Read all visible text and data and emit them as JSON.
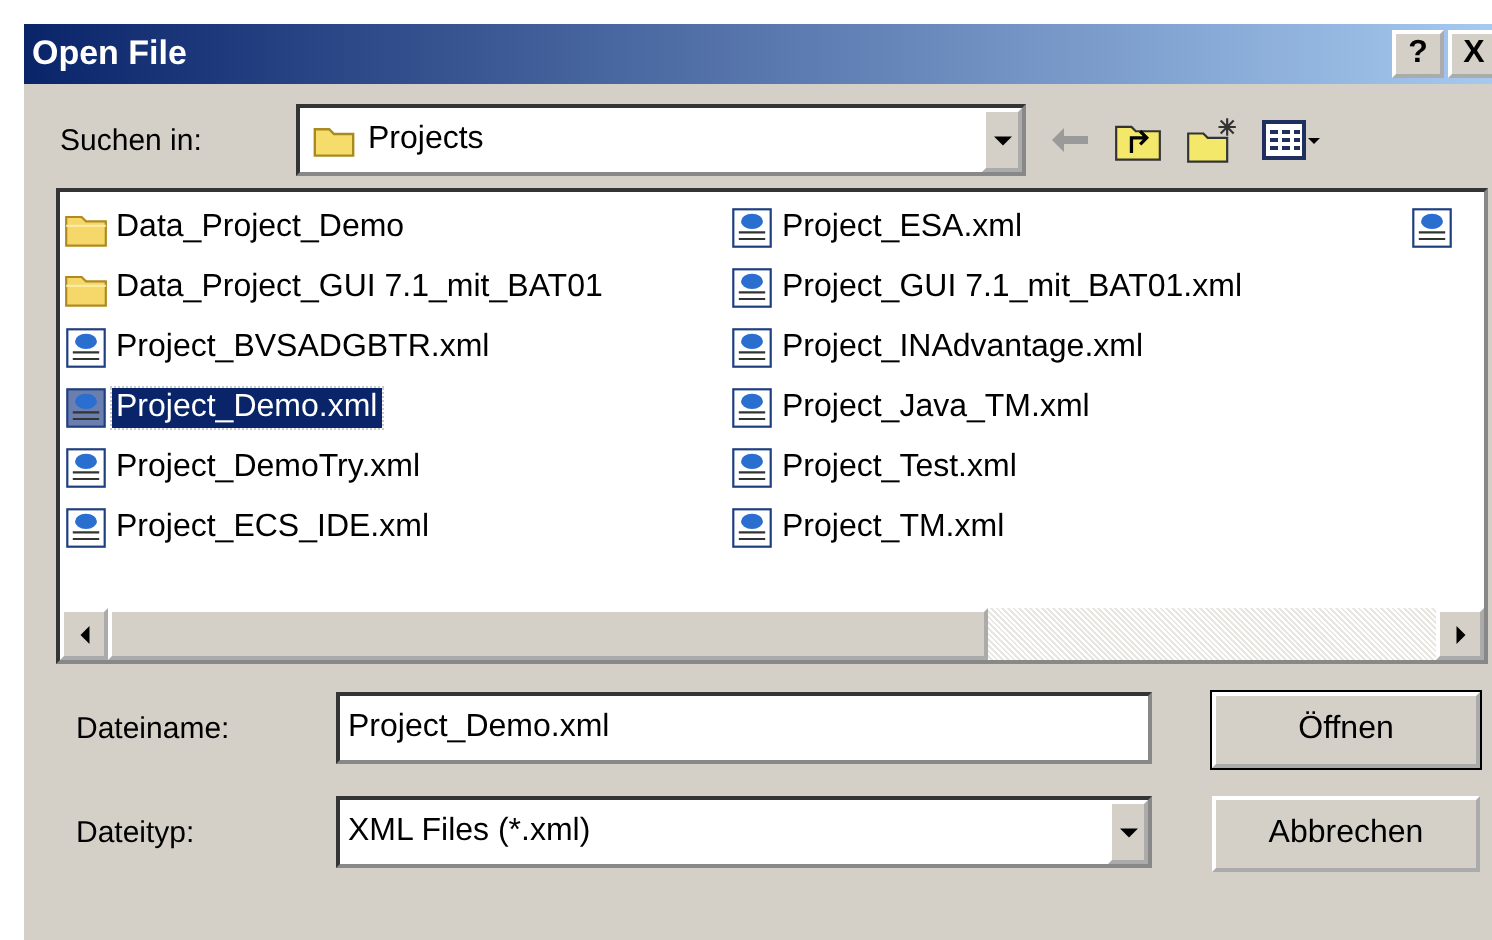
{
  "window": {
    "title": "Open File",
    "help_button": "?",
    "close_button": "X"
  },
  "look_in": {
    "label": "Suchen in:",
    "value": "Projects"
  },
  "files": [
    {
      "kind": "folder",
      "name": "Data_Project_Demo",
      "selected": false
    },
    {
      "kind": "folder",
      "name": "Data_Project_GUI 7.1_mit_BAT01",
      "selected": false
    },
    {
      "kind": "file",
      "name": "Project_BVSADGBTR.xml",
      "selected": false
    },
    {
      "kind": "file",
      "name": "Project_Demo.xml",
      "selected": true
    },
    {
      "kind": "file",
      "name": "Project_DemoTry.xml",
      "selected": false
    },
    {
      "kind": "file",
      "name": "Project_ECS_IDE.xml",
      "selected": false
    },
    {
      "kind": "file",
      "name": "Project_ESA.xml",
      "selected": false
    },
    {
      "kind": "file",
      "name": "Project_GUI 7.1_mit_BAT01.xml",
      "selected": false
    },
    {
      "kind": "file",
      "name": "Project_INAdvantage.xml",
      "selected": false
    },
    {
      "kind": "file",
      "name": "Project_Java_TM.xml",
      "selected": false
    },
    {
      "kind": "file",
      "name": "Project_Test.xml",
      "selected": false
    },
    {
      "kind": "file",
      "name": "Project_TM.xml",
      "selected": false
    },
    {
      "kind": "file",
      "selected": false
    }
  ],
  "file_name": {
    "label": "Dateiname:",
    "value": "Project_Demo.xml"
  },
  "file_type": {
    "label": "Dateityp:",
    "value": "XML Files (*.xml)"
  },
  "buttons": [
    "Öffnen",
    "Abbrechen"
  ]
}
